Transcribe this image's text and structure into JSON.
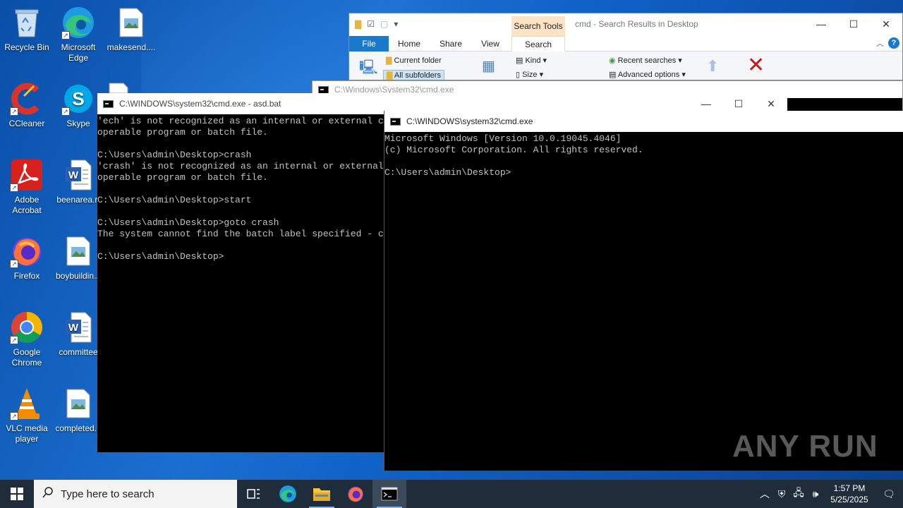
{
  "desktop": {
    "icons": [
      {
        "label": "Recycle Bin",
        "icon": "recycle-bin-icon"
      },
      {
        "label": "Microsoft Edge",
        "icon": "edge-icon"
      },
      {
        "label": "makesend....",
        "icon": "image-file-icon"
      },
      {
        "label": "CCleaner",
        "icon": "ccleaner-icon"
      },
      {
        "label": "Skype",
        "icon": "skype-icon"
      },
      {
        "label": "Adobe Acrobat",
        "icon": "acrobat-icon"
      },
      {
        "label": "beenarea.rt",
        "icon": "word-doc-icon"
      },
      {
        "label": "Firefox",
        "icon": "firefox-icon"
      },
      {
        "label": "boybuildin...",
        "icon": "image-file-icon"
      },
      {
        "label": "Google Chrome",
        "icon": "chrome-icon"
      },
      {
        "label": "committee",
        "icon": "word-doc-icon"
      },
      {
        "label": "VLC media player",
        "icon": "vlc-icon"
      },
      {
        "label": "completed...",
        "icon": "image-file-icon"
      }
    ]
  },
  "explorer": {
    "context_tab": "Search Tools",
    "title": "cmd - Search Results in Desktop",
    "tabs": [
      "File",
      "Home",
      "Share",
      "View",
      "Search"
    ],
    "ribbon": {
      "current_folder": "Current folder",
      "all_subfolders": "All subfolders",
      "kind": "Kind",
      "size": "Size",
      "recent_searches": "Recent searches",
      "advanced_options": "Advanced options"
    },
    "help": "?"
  },
  "cmd_back": {
    "title": "C:\\Windows\\System32\\cmd.exe"
  },
  "cmd_left": {
    "title": "C:\\WINDOWS\\system32\\cmd.exe - asd.bat",
    "output": "'ech' is not recognized as an internal or external command,\noperable program or batch file.\n\nC:\\Users\\admin\\Desktop>crash\n'crash' is not recognized as an internal or external command,\noperable program or batch file.\n\nC:\\Users\\admin\\Desktop>start\n\nC:\\Users\\admin\\Desktop>goto crash\nThe system cannot find the batch label specified - crash\n\nC:\\Users\\admin\\Desktop>"
  },
  "cmd_right": {
    "title": "C:\\WINDOWS\\system32\\cmd.exe",
    "output": "Microsoft Windows [Version 10.0.19045.4046]\n(c) Microsoft Corporation. All rights reserved.\n\nC:\\Users\\admin\\Desktop>"
  },
  "window_controls": {
    "minimize": "—",
    "maximize": "☐",
    "close": "✕"
  },
  "taskbar": {
    "search_placeholder": "Type here to search",
    "time": "1:57 PM",
    "date": "5/25/2025"
  },
  "watermark": "ANY RUN",
  "colors": {
    "accent": "#1979ca",
    "taskbar": "#1f2d3a",
    "console_text": "#c0c0c0"
  }
}
